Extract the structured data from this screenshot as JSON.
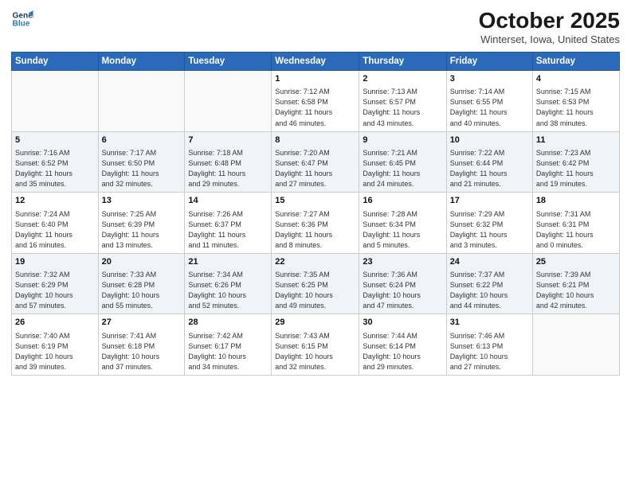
{
  "logo": {
    "line1": "General",
    "line2": "Blue"
  },
  "header": {
    "title": "October 2025",
    "subtitle": "Winterset, Iowa, United States"
  },
  "days_of_week": [
    "Sunday",
    "Monday",
    "Tuesday",
    "Wednesday",
    "Thursday",
    "Friday",
    "Saturday"
  ],
  "weeks": [
    [
      {
        "day": "",
        "info": ""
      },
      {
        "day": "",
        "info": ""
      },
      {
        "day": "",
        "info": ""
      },
      {
        "day": "1",
        "info": "Sunrise: 7:12 AM\nSunset: 6:58 PM\nDaylight: 11 hours\nand 46 minutes."
      },
      {
        "day": "2",
        "info": "Sunrise: 7:13 AM\nSunset: 6:57 PM\nDaylight: 11 hours\nand 43 minutes."
      },
      {
        "day": "3",
        "info": "Sunrise: 7:14 AM\nSunset: 6:55 PM\nDaylight: 11 hours\nand 40 minutes."
      },
      {
        "day": "4",
        "info": "Sunrise: 7:15 AM\nSunset: 6:53 PM\nDaylight: 11 hours\nand 38 minutes."
      }
    ],
    [
      {
        "day": "5",
        "info": "Sunrise: 7:16 AM\nSunset: 6:52 PM\nDaylight: 11 hours\nand 35 minutes."
      },
      {
        "day": "6",
        "info": "Sunrise: 7:17 AM\nSunset: 6:50 PM\nDaylight: 11 hours\nand 32 minutes."
      },
      {
        "day": "7",
        "info": "Sunrise: 7:18 AM\nSunset: 6:48 PM\nDaylight: 11 hours\nand 29 minutes."
      },
      {
        "day": "8",
        "info": "Sunrise: 7:20 AM\nSunset: 6:47 PM\nDaylight: 11 hours\nand 27 minutes."
      },
      {
        "day": "9",
        "info": "Sunrise: 7:21 AM\nSunset: 6:45 PM\nDaylight: 11 hours\nand 24 minutes."
      },
      {
        "day": "10",
        "info": "Sunrise: 7:22 AM\nSunset: 6:44 PM\nDaylight: 11 hours\nand 21 minutes."
      },
      {
        "day": "11",
        "info": "Sunrise: 7:23 AM\nSunset: 6:42 PM\nDaylight: 11 hours\nand 19 minutes."
      }
    ],
    [
      {
        "day": "12",
        "info": "Sunrise: 7:24 AM\nSunset: 6:40 PM\nDaylight: 11 hours\nand 16 minutes."
      },
      {
        "day": "13",
        "info": "Sunrise: 7:25 AM\nSunset: 6:39 PM\nDaylight: 11 hours\nand 13 minutes."
      },
      {
        "day": "14",
        "info": "Sunrise: 7:26 AM\nSunset: 6:37 PM\nDaylight: 11 hours\nand 11 minutes."
      },
      {
        "day": "15",
        "info": "Sunrise: 7:27 AM\nSunset: 6:36 PM\nDaylight: 11 hours\nand 8 minutes."
      },
      {
        "day": "16",
        "info": "Sunrise: 7:28 AM\nSunset: 6:34 PM\nDaylight: 11 hours\nand 5 minutes."
      },
      {
        "day": "17",
        "info": "Sunrise: 7:29 AM\nSunset: 6:32 PM\nDaylight: 11 hours\nand 3 minutes."
      },
      {
        "day": "18",
        "info": "Sunrise: 7:31 AM\nSunset: 6:31 PM\nDaylight: 11 hours\nand 0 minutes."
      }
    ],
    [
      {
        "day": "19",
        "info": "Sunrise: 7:32 AM\nSunset: 6:29 PM\nDaylight: 10 hours\nand 57 minutes."
      },
      {
        "day": "20",
        "info": "Sunrise: 7:33 AM\nSunset: 6:28 PM\nDaylight: 10 hours\nand 55 minutes."
      },
      {
        "day": "21",
        "info": "Sunrise: 7:34 AM\nSunset: 6:26 PM\nDaylight: 10 hours\nand 52 minutes."
      },
      {
        "day": "22",
        "info": "Sunrise: 7:35 AM\nSunset: 6:25 PM\nDaylight: 10 hours\nand 49 minutes."
      },
      {
        "day": "23",
        "info": "Sunrise: 7:36 AM\nSunset: 6:24 PM\nDaylight: 10 hours\nand 47 minutes."
      },
      {
        "day": "24",
        "info": "Sunrise: 7:37 AM\nSunset: 6:22 PM\nDaylight: 10 hours\nand 44 minutes."
      },
      {
        "day": "25",
        "info": "Sunrise: 7:39 AM\nSunset: 6:21 PM\nDaylight: 10 hours\nand 42 minutes."
      }
    ],
    [
      {
        "day": "26",
        "info": "Sunrise: 7:40 AM\nSunset: 6:19 PM\nDaylight: 10 hours\nand 39 minutes."
      },
      {
        "day": "27",
        "info": "Sunrise: 7:41 AM\nSunset: 6:18 PM\nDaylight: 10 hours\nand 37 minutes."
      },
      {
        "day": "28",
        "info": "Sunrise: 7:42 AM\nSunset: 6:17 PM\nDaylight: 10 hours\nand 34 minutes."
      },
      {
        "day": "29",
        "info": "Sunrise: 7:43 AM\nSunset: 6:15 PM\nDaylight: 10 hours\nand 32 minutes."
      },
      {
        "day": "30",
        "info": "Sunrise: 7:44 AM\nSunset: 6:14 PM\nDaylight: 10 hours\nand 29 minutes."
      },
      {
        "day": "31",
        "info": "Sunrise: 7:46 AM\nSunset: 6:13 PM\nDaylight: 10 hours\nand 27 minutes."
      },
      {
        "day": "",
        "info": ""
      }
    ]
  ],
  "colors": {
    "header_bg": "#2a6ab8",
    "accent": "#1a3a5c"
  }
}
